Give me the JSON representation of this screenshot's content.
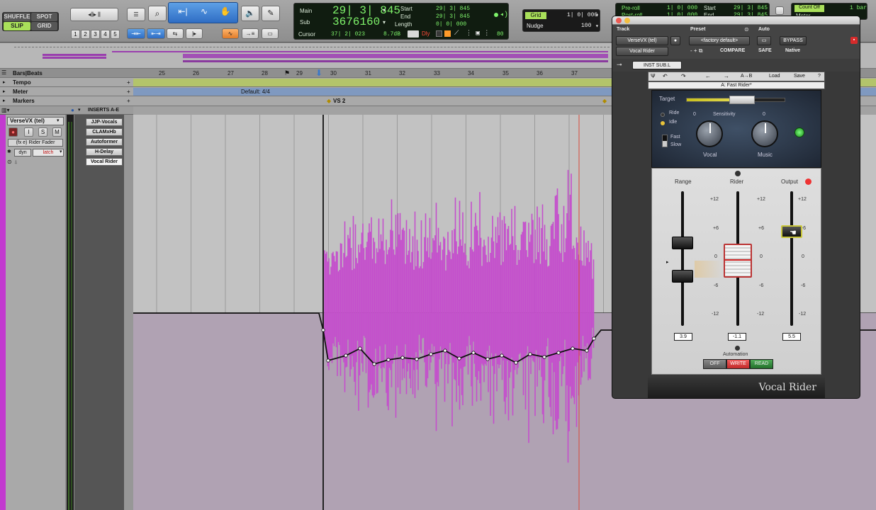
{
  "toolbar": {
    "edit_modes": {
      "shuffle": "SHUFFLE",
      "spot": "SPOT",
      "slip": "SLIP",
      "grid": "GRID"
    },
    "zoom_presets": [
      "1",
      "2",
      "3",
      "4",
      "5"
    ],
    "counter": {
      "main_label": "Main",
      "main_value": "29| 3| 845",
      "sub_label": "Sub",
      "sub_value": "3676160",
      "cursor_label": "Cursor",
      "cursor_value": "37| 2| 023",
      "cursor_db": "8.7dB",
      "start_label": "Start",
      "start_value": "29| 3| 845",
      "end_label": "End",
      "end_value": "29| 3| 845",
      "length_label": "Length",
      "length_value": "0| 0| 000",
      "dly_label": "Dly",
      "tempo_value": "80"
    },
    "grid": {
      "label": "Grid",
      "value": "1| 0| 000",
      "nudge_label": "Nudge",
      "nudge_value": "100"
    },
    "transport": {
      "preroll_label": "Pre-roll",
      "preroll_value": "1| 0| 000",
      "postroll_label": "Post-roll",
      "postroll_value": "1| 0| 000",
      "start_label": "Start",
      "start_value": "29| 3| 845",
      "end_label": "End",
      "end_value": "29| 3| 845",
      "countoff_label": "Count Off",
      "countoff_value": "1 bar",
      "meter_label": "Meter"
    }
  },
  "rulers": {
    "bars_label": "Bars|Beats",
    "bars": [
      "25",
      "26",
      "27",
      "28",
      "29",
      "30",
      "31",
      "32",
      "33",
      "34",
      "35",
      "36",
      "37"
    ],
    "tempo_label": "Tempo",
    "meter_label": "Meter",
    "meter_value": "Default: 4/4",
    "markers_label": "Markers",
    "marker_name": "VS 2"
  },
  "track": {
    "name": "VerseVX (tel)",
    "rec_label": "●",
    "input_label": "I",
    "solo_label": "S",
    "mute_label": "M",
    "playlist_view": "(fx e) Rider Fader",
    "dyn_label": "dyn",
    "automation_mode": "latch",
    "inserts_header": "INSERTS A-E",
    "inserts": [
      "JJP-Vocals",
      "CLAMxHb",
      "Autoformer",
      "H-Delay",
      "Vocal Rider"
    ]
  },
  "plugin": {
    "header": {
      "track_label": "Track",
      "preset_label": "Preset",
      "auto_label": "Auto",
      "track_name": "VerseVX (tel)",
      "insert_name": "Vocal Rider",
      "preset_name": "<factory default>",
      "compare_label": "COMPARE",
      "safe_label": "SAFE",
      "bypass_label": "BYPASS",
      "native_label": "Native",
      "sidechain": "INST SUB.L"
    },
    "waves_bar": {
      "load": "Load",
      "save": "Save",
      "help": "?",
      "ab": "A→B",
      "preset_title": "A: Fast Rider*"
    },
    "target_label": "Target",
    "sensitivity_label": "Sensitivity",
    "ride_label": "Ride",
    "idle_label": "Idle",
    "fast_label": "Fast",
    "slow_label": "Slow",
    "vocal_label": "Vocal",
    "music_label": "Music",
    "knob_zero": "0",
    "range_label": "Range",
    "rider_label": "Rider",
    "output_label": "Output",
    "scale": [
      "+12",
      "+6",
      "0",
      "-6",
      "-12"
    ],
    "range_value": "3.9",
    "rider_value": "-1.1",
    "output_value": "5.5",
    "automation_label": "Automation",
    "auto_off": "OFF",
    "auto_write": "WRITE",
    "auto_read": "READ",
    "brand": "Vocal Rider"
  },
  "colors": {
    "accent": "#c63ad6",
    "waveform": "#c44fcc",
    "counter_green": "#7ef26a",
    "write": "#d33b3b",
    "read": "#2f8a3a"
  }
}
